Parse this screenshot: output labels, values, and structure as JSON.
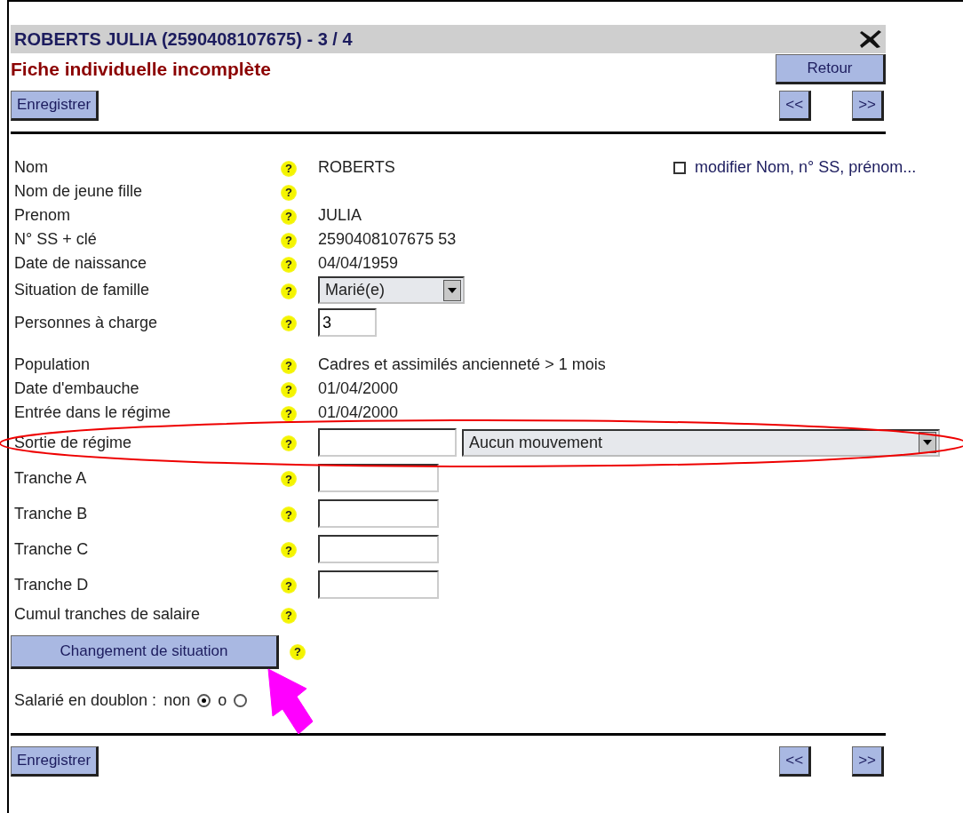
{
  "header": {
    "title": "ROBERTS JULIA (2590408107675) - 3 / 4",
    "subtitle": "Fiche individuelle incomplète",
    "save_button": "Enregistrer",
    "back_button": "Retour",
    "prev_button": "<<",
    "next_button": ">>"
  },
  "modify_option": {
    "label": "modifier Nom, n° SS, prénom...",
    "checked": false
  },
  "fields": [
    {
      "kind": "text",
      "label": "Nom",
      "help": "?",
      "value": "ROBERTS"
    },
    {
      "kind": "none",
      "label": "Nom de jeune fille",
      "help": "?"
    },
    {
      "kind": "text",
      "label": "Prenom",
      "help": "?",
      "value": "JULIA"
    },
    {
      "kind": "text",
      "label": "N° SS + clé",
      "help": "?",
      "value": "2590408107675 53"
    },
    {
      "kind": "text",
      "label": "Date de naissance",
      "help": "?",
      "value": "04/04/1959"
    },
    {
      "kind": "select",
      "label": "Situation de famille",
      "help": "?",
      "value": "Marié(e)"
    },
    {
      "kind": "input",
      "label": "Personnes à charge",
      "help": "?",
      "value": "3"
    },
    {
      "kind": "text",
      "label": "Population",
      "help": "?",
      "value": "Cadres et assimilés ancienneté > 1 mois"
    },
    {
      "kind": "text",
      "label": "Date d'embauche",
      "help": "?",
      "value": "01/04/2000"
    },
    {
      "kind": "text",
      "label": "Entrée dans le régime",
      "help": "?",
      "value": "01/04/2000"
    },
    {
      "kind": "input_select",
      "label": "Sortie de régime",
      "help": "?",
      "select": "Aucun mouvement"
    },
    {
      "kind": "input",
      "label": "Tranche A",
      "help": "?"
    },
    {
      "kind": "input",
      "label": "Tranche B",
      "help": "?"
    },
    {
      "kind": "input",
      "label": "Tranche C",
      "help": "?"
    },
    {
      "kind": "input",
      "label": "Tranche D",
      "help": "?"
    },
    {
      "kind": "none",
      "label": "Cumul tranches de salaire",
      "help": "?"
    }
  ],
  "situation_button": {
    "label": "Changement de situation",
    "help": "?"
  },
  "duplicate": {
    "label": "Salarié en doublon :",
    "options": [
      {
        "label": "non",
        "selected": true
      },
      {
        "label": "o",
        "selected": false
      }
    ]
  },
  "footer": {
    "save_button": "Enregistrer",
    "prev_button": "<<",
    "next_button": ">>"
  }
}
